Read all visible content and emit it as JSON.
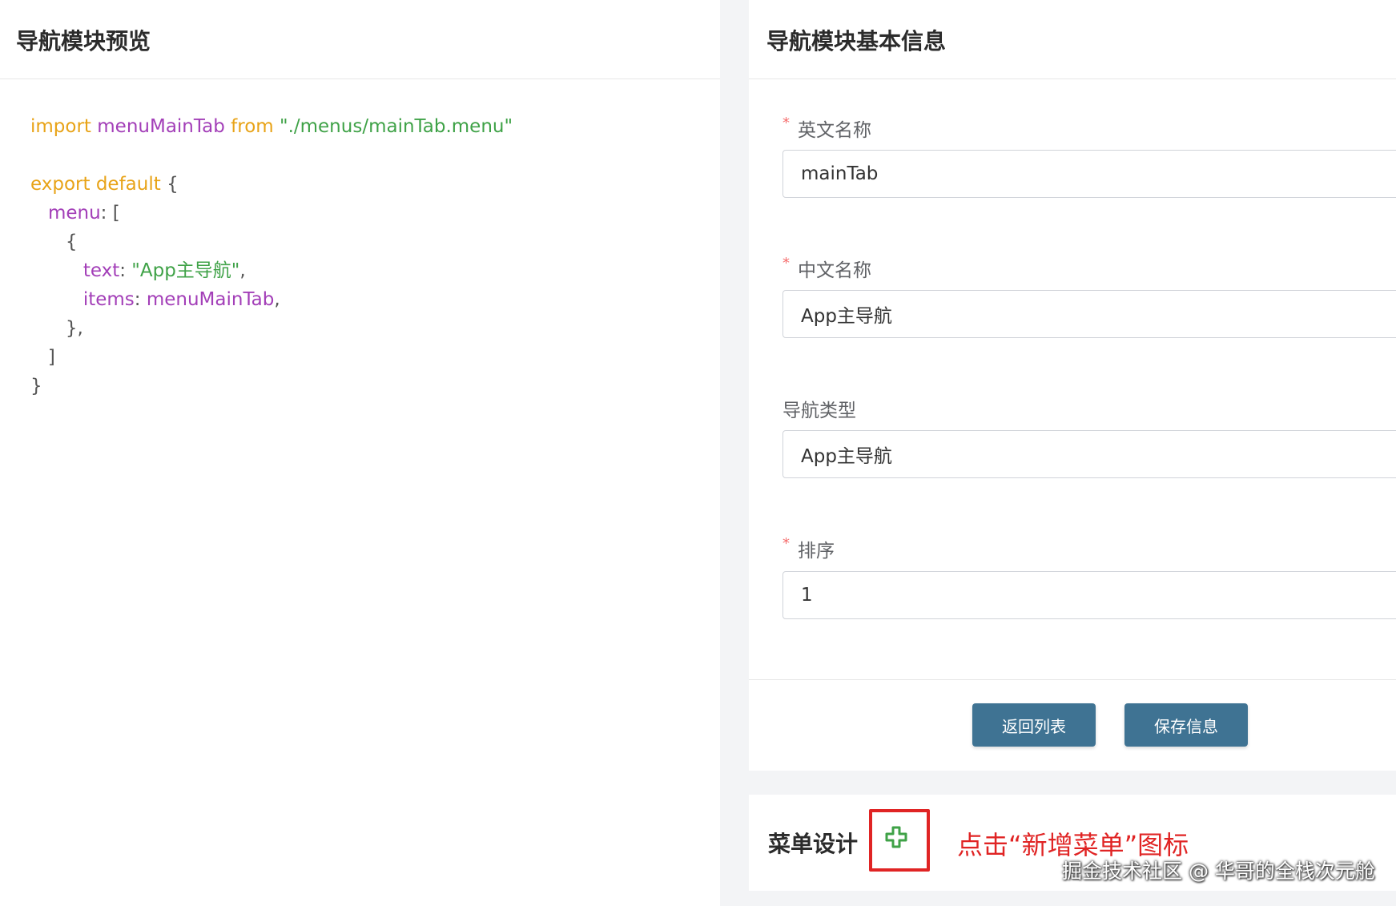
{
  "preview": {
    "title": "导航模块预览",
    "code": [
      [
        [
          "kw",
          "import "
        ],
        [
          "id",
          "menuMainTab "
        ],
        [
          "kw",
          "from "
        ],
        [
          "str",
          "\"./menus/mainTab.menu\""
        ]
      ],
      [],
      [
        [
          "kw",
          "export default "
        ],
        [
          "pn",
          "{"
        ]
      ],
      [
        [
          "pn",
          "   "
        ],
        [
          "id",
          "menu"
        ],
        [
          "pn",
          ": ["
        ]
      ],
      [
        [
          "pn",
          "      {"
        ]
      ],
      [
        [
          "pn",
          "         "
        ],
        [
          "id",
          "text"
        ],
        [
          "pn",
          ": "
        ],
        [
          "str",
          "\"App主导航\""
        ],
        [
          "pn",
          ","
        ]
      ],
      [
        [
          "pn",
          "         "
        ],
        [
          "id",
          "items"
        ],
        [
          "pn",
          ": "
        ],
        [
          "id",
          "menuMainTab"
        ],
        [
          "pn",
          ","
        ]
      ],
      [
        [
          "pn",
          "      },"
        ]
      ],
      [
        [
          "pn",
          "   ]"
        ]
      ],
      [
        [
          "pn",
          "}"
        ]
      ]
    ]
  },
  "form": {
    "title": "导航模块基本信息",
    "fields": [
      {
        "label": "英文名称",
        "required": "*",
        "value": "mainTab"
      },
      {
        "label": "中文名称",
        "required": "*",
        "value": "App主导航"
      },
      {
        "label": "导航类型",
        "required": "",
        "value": "App主导航"
      },
      {
        "label": "排序",
        "required": "*",
        "value": "1"
      }
    ],
    "back_label": "返回列表",
    "save_label": "保存信息"
  },
  "menu_design": {
    "title": "菜单设计",
    "add_icon": "plus-icon",
    "annotation": "点击“新增菜单”图标"
  },
  "watermark": "掘金技术社区 @ 华哥的全栈次元舱",
  "colors": {
    "keyword": "#e8a317",
    "identifier": "#a33fb8",
    "string": "#3fa247",
    "button": "#3f7393",
    "required": "#f56c6c",
    "highlight": "#e02424",
    "plus": "#3fa247"
  }
}
